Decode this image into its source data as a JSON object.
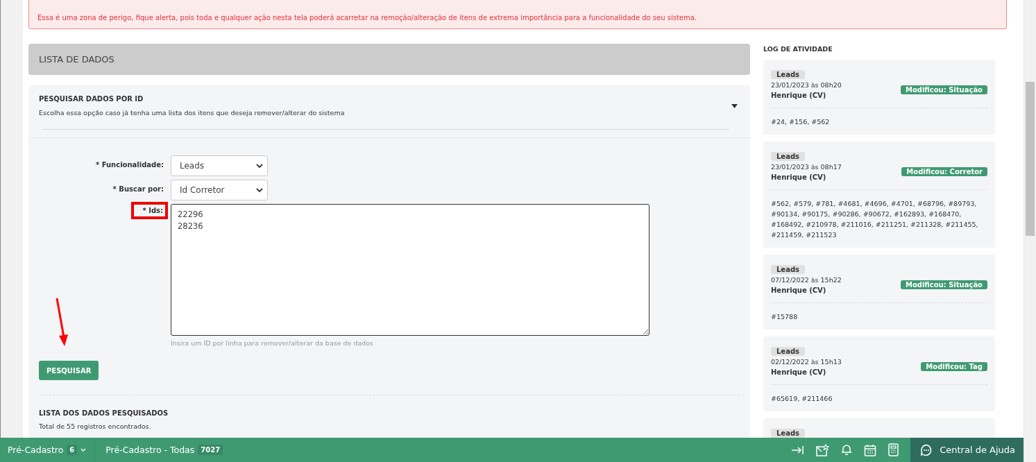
{
  "alert": {
    "text": "Essa é uma zona de perigo, fique alerta, pois toda e qualquer ação nesta tela poderá acarretar na remoção/alteração de itens de extrema importância para a funcionalidade do seu sistema."
  },
  "section": {
    "title": "LISTA DE DADOS"
  },
  "search_panel": {
    "title": "PESQUISAR DADOS POR ID",
    "description": "Escolha essa opção caso já tenha uma lista dos itens que deseja remover/alterar do sistema",
    "expanded": true,
    "fields": [
      {
        "kind": "select",
        "label": "* Funcionalidade:",
        "value": "Leads",
        "highlighted": false
      },
      {
        "kind": "select",
        "label": "* Buscar por:",
        "value": "Id Corretor",
        "highlighted": false
      },
      {
        "kind": "textarea",
        "label": "* Ids:",
        "value": "22296\n28236",
        "highlighted": true
      }
    ],
    "hint": "Insira um ID por linha para remover/alterar da base de dados",
    "button": "PESQUISAR"
  },
  "results": {
    "title": "LISTA DOS DADOS PESQUISADOS",
    "summary": "Total de 55 registros encontrados."
  },
  "log": {
    "title": "LOG DE ATIVIDADE",
    "entries": [
      {
        "module": "Leads",
        "datetime": "23/01/2023 às 08h20",
        "user": "Henrique (CV)",
        "action": "Modificou: Situação",
        "ids": "#24, #156, #562"
      },
      {
        "module": "Leads",
        "datetime": "23/01/2023 às 08h17",
        "user": "Henrique (CV)",
        "action": "Modificou: Corretor",
        "ids": "#562, #579, #781, #4681, #4696, #4701, #68796, #89793, #90134, #90175, #90286, #90672, #162893, #168470, #168492, #210978, #211016, #211251, #211328, #211455, #211459, #211523"
      },
      {
        "module": "Leads",
        "datetime": "07/12/2022 às 15h22",
        "user": "Henrique (CV)",
        "action": "Modificou: Situação",
        "ids": "#15788"
      },
      {
        "module": "Leads",
        "datetime": "02/12/2022 às 15h13",
        "user": "Henrique (CV)",
        "action": "Modificou: Tag",
        "ids": "#65619, #211466"
      },
      {
        "module": "Leads"
      }
    ]
  },
  "bottom_bar": {
    "items": [
      {
        "label": "Pré-Cadastro",
        "count": "6",
        "dropdown": true
      },
      {
        "label": "Pré-Cadastro - Todas",
        "count": "7027",
        "dropdown": false
      }
    ],
    "help": "Central de Ajuda"
  }
}
